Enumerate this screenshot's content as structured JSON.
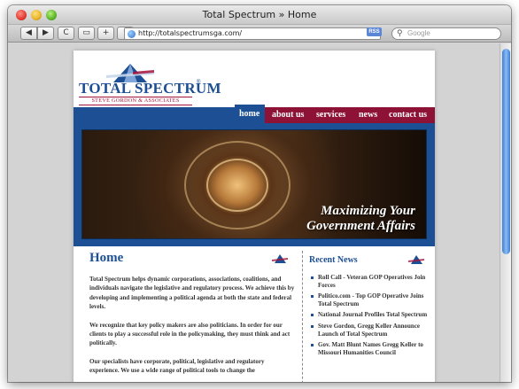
{
  "window": {
    "title": "Total Spectrum » Home"
  },
  "toolbar": {
    "back": "◀",
    "forward": "▶",
    "reload": "C",
    "snapshot": "▭",
    "add": "+",
    "share": "⇡",
    "url": "http://totalspectrumsga.com/",
    "rss": "RSS",
    "search_placeholder": "Google"
  },
  "logo": {
    "name": "TOTAL SPECTRUM",
    "reg": "®",
    "tagline": "STEVE GORDON & ASSOCIATES"
  },
  "nav": [
    "home",
    "about us",
    "services",
    "news",
    "contact us"
  ],
  "hero": {
    "line1": "Maximizing Your",
    "line2": "Government Affairs"
  },
  "main": {
    "heading": "Home",
    "paragraphs": [
      "Total Spectrum helps dynamic corporations, associations, coalitions, and individuals navigate the legislative and regulatory process. We achieve this by developing and implementing a political agenda at both the state and federal levels.",
      "We recognize that key policy makers are also politicians. In order for our clients to play a successful role in the policymaking, they must think and act politically.",
      "Our specialists have corporate, political, legislative and regulatory experience. We use a wide range of political tools to change the"
    ]
  },
  "sidebar": {
    "heading": "Recent News",
    "items": [
      "Roll Call - Veteran GOP Operatives Join Forces",
      "Politico.com - Top GOP Operative Joins Total Spectrum",
      "National Journal Profiles Total Spectrum",
      "Steve Gordon, Gregg Keller Announce Launch of Total Spectrum",
      "Gov. Matt Blunt Names Gregg Keller to Missouri Humanities Council"
    ]
  },
  "colors": {
    "brand_blue": "#1d4f94",
    "brand_red": "#8e1235",
    "scroll_blue": "#3b7dd8"
  }
}
